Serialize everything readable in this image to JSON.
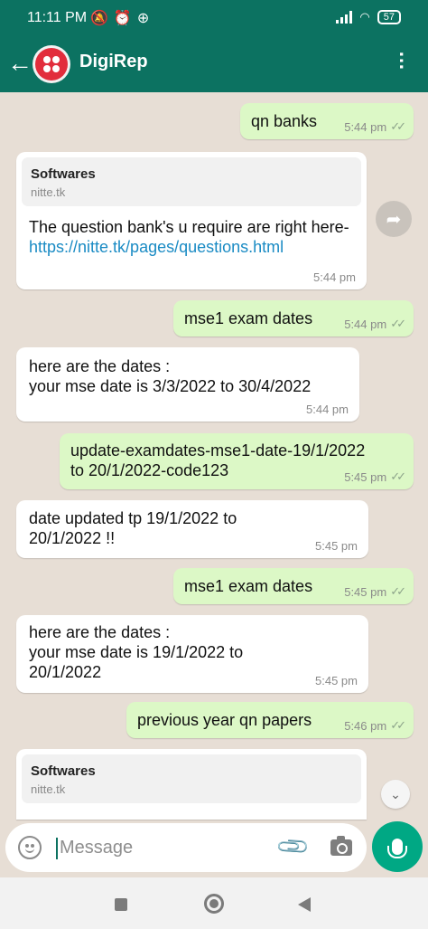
{
  "status_bar": {
    "time": "11:11 PM",
    "icons": [
      "mute-icon",
      "alarm-icon",
      "add-circle-icon"
    ],
    "battery": "57"
  },
  "header": {
    "title": "DigiRep",
    "back_icon": "arrow-left-icon",
    "menu_icon": "more-vertical-icon"
  },
  "messages": [
    {
      "direction": "out",
      "text": "qn banks",
      "time": "5:44 pm"
    },
    {
      "direction": "in",
      "preview_title": "Softwares",
      "preview_site": "nitte.tk",
      "text": "The question bank's u require are right here- ",
      "link": "https://nitte.tk/pages/questions.html",
      "time": "5:44 pm"
    },
    {
      "direction": "out",
      "text": "mse1 exam dates",
      "time": "5:44 pm"
    },
    {
      "direction": "in",
      "text": "here are the dates :\n your mse date is 3/3/2022 to 30/4/2022",
      "time": "5:44 pm"
    },
    {
      "direction": "out",
      "text": "update-examdates-mse1-date-19/1/2022\nto 20/1/2022-code123",
      "time": "5:45 pm"
    },
    {
      "direction": "in",
      "text": "date updated tp 19/1/2022 to\n20/1/2022 !!",
      "time": "5:45 pm"
    },
    {
      "direction": "out",
      "text": "mse1 exam dates",
      "time": "5:45 pm"
    },
    {
      "direction": "in",
      "text": "here are the dates :\n your mse date is 19/1/2022 to\n20/1/2022",
      "time": "5:45 pm"
    },
    {
      "direction": "out",
      "text": "previous year qn papers",
      "time": "5:46 pm"
    },
    {
      "direction": "in",
      "preview_title": "Softwares",
      "preview_site": "nitte.tk"
    }
  ],
  "input": {
    "placeholder": "Message"
  },
  "colors": {
    "header": "#0c7261",
    "outgoing_bubble": "#dcf8c6",
    "incoming_bubble": "#ffffff",
    "send_button": "#00a884",
    "link": "#1a8bc4"
  }
}
